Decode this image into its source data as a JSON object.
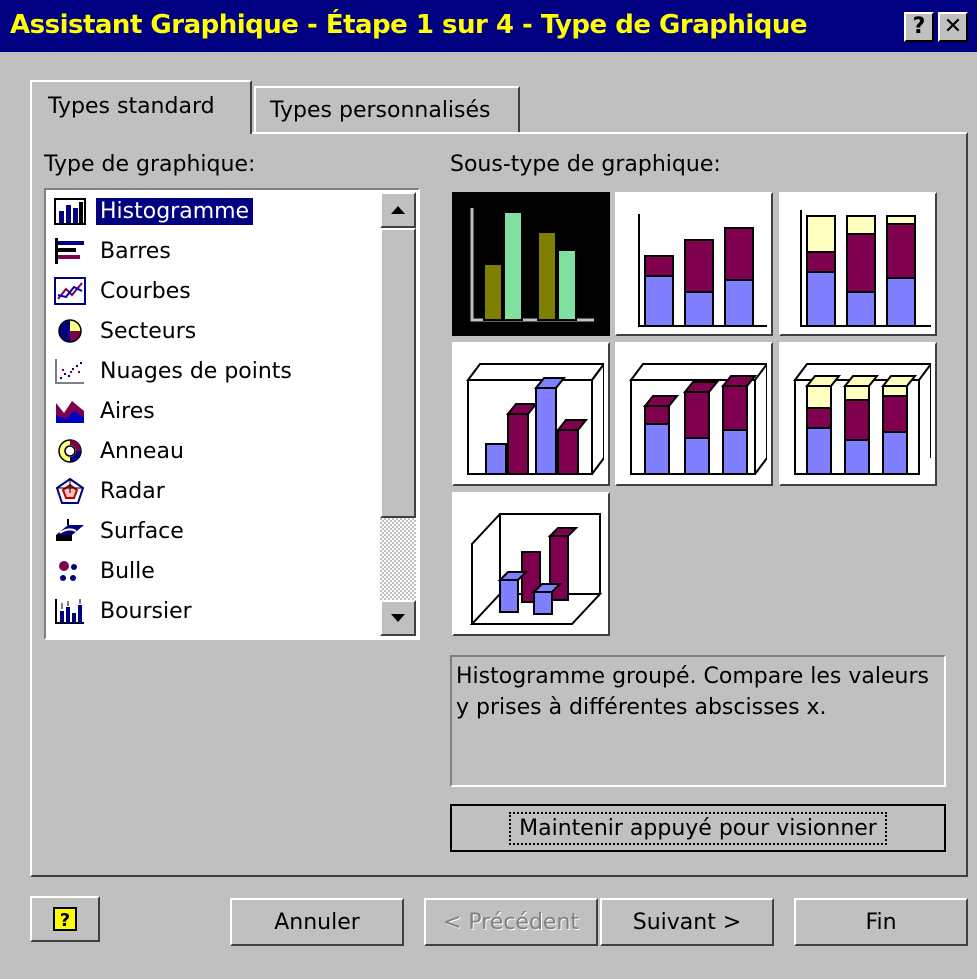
{
  "window": {
    "title": "Assistant Graphique - Étape 1 sur 4 - Type de Graphique",
    "help_glyph": "?",
    "close_glyph": "✕"
  },
  "tabs": [
    {
      "label": "Types standard",
      "active": true
    },
    {
      "label": "Types personnalisés",
      "active": false
    }
  ],
  "chart_type_label": "Type de graphique:",
  "chart_types": [
    {
      "label": "Histogramme",
      "icon": "column-chart-icon",
      "selected": true
    },
    {
      "label": "Barres",
      "icon": "bar-chart-icon"
    },
    {
      "label": "Courbes",
      "icon": "line-chart-icon"
    },
    {
      "label": "Secteurs",
      "icon": "pie-chart-icon"
    },
    {
      "label": "Nuages de points",
      "icon": "scatter-chart-icon"
    },
    {
      "label": "Aires",
      "icon": "area-chart-icon"
    },
    {
      "label": "Anneau",
      "icon": "doughnut-chart-icon"
    },
    {
      "label": "Radar",
      "icon": "radar-chart-icon"
    },
    {
      "label": "Surface",
      "icon": "surface-chart-icon"
    },
    {
      "label": "Bulle",
      "icon": "bubble-chart-icon"
    },
    {
      "label": "Boursier",
      "icon": "stock-chart-icon"
    }
  ],
  "subtype_label": "Sous-type de graphique:",
  "subtypes": [
    {
      "name": "clustered-column",
      "selected": true
    },
    {
      "name": "stacked-column"
    },
    {
      "name": "100-percent-stacked-column"
    },
    {
      "name": "3d-clustered-column"
    },
    {
      "name": "3d-stacked-column"
    },
    {
      "name": "3d-100-percent-stacked-column"
    },
    {
      "name": "3d-column"
    }
  ],
  "description": "Histogramme groupé. Compare les valeurs y prises à différentes abscisses x.",
  "preview_button": "Maintenir appuyé pour visionner",
  "buttons": {
    "help_icon": "help-icon",
    "cancel": "Annuler",
    "previous": "< Précédent",
    "next": "Suivant >",
    "finish": "Fin"
  },
  "colors": {
    "title_bg": "#000080",
    "title_fg": "#ffff00",
    "selection": "#000080",
    "series_blue": "#8080ff",
    "series_plum": "#800050",
    "series_cream": "#ffffc0",
    "series_olive": "#808000",
    "series_mint": "#80e0a0"
  }
}
